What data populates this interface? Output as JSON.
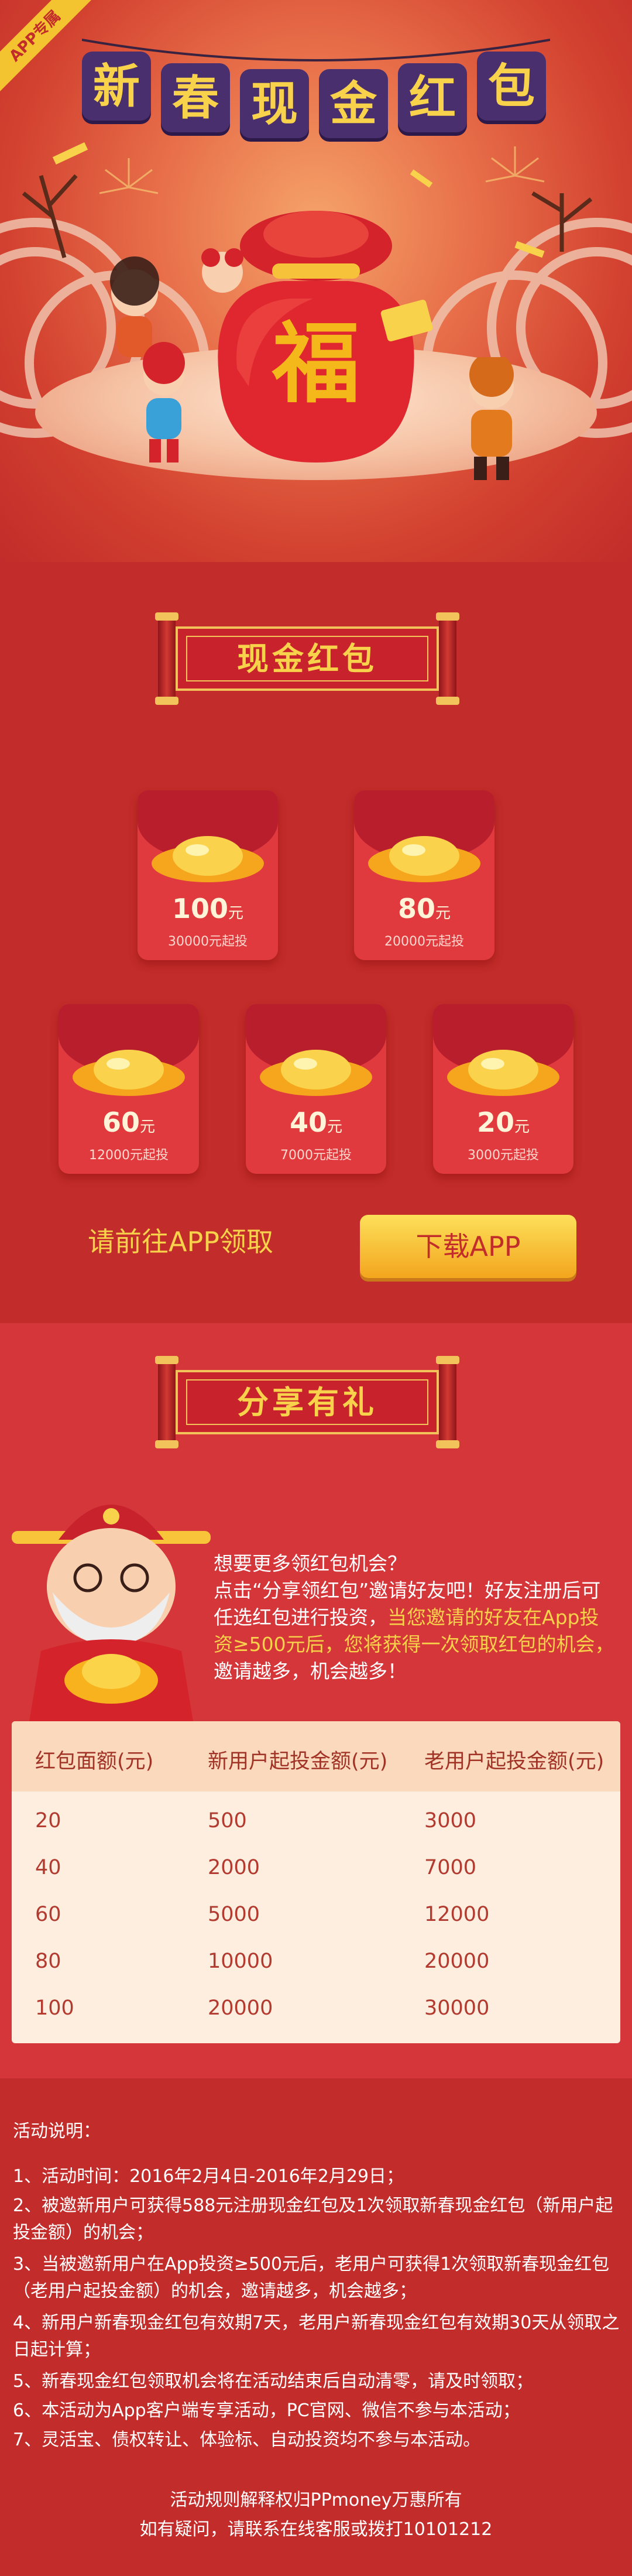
{
  "ribbon": "APP专属",
  "title_chars": [
    "新",
    "春",
    "现",
    "金",
    "红",
    "包"
  ],
  "bag_char": "福",
  "section1": {
    "banner": "现金红包",
    "envelopes": [
      {
        "amount": "100",
        "unit": "元",
        "condition": "30000元起投"
      },
      {
        "amount": "80",
        "unit": "元",
        "condition": "20000元起投"
      },
      {
        "amount": "60",
        "unit": "元",
        "condition": "12000元起投"
      },
      {
        "amount": "40",
        "unit": "元",
        "condition": "7000元起投"
      },
      {
        "amount": "20",
        "unit": "元",
        "condition": "3000元起投"
      }
    ],
    "goto_text": "请前往APP领取",
    "download_button": "下载APP"
  },
  "section2": {
    "banner": "分享有礼",
    "text_line1": "想要更多领红包机会？",
    "text_line2": "点击“分享领红包”邀请好友吧！好友注册后可任选红包进行投资，",
    "text_highlight": "当您邀请的好友在App投资≥500元后，您将获得一次领取红包的机会，",
    "text_end": "邀请越多，机会越多！",
    "table": {
      "headers": [
        "红包面额(元)",
        "新用户起投金额(元)",
        "老用户起投金额(元)"
      ],
      "rows": [
        [
          "20",
          "500",
          "3000"
        ],
        [
          "40",
          "2000",
          "7000"
        ],
        [
          "60",
          "5000",
          "12000"
        ],
        [
          "80",
          "10000",
          "20000"
        ],
        [
          "100",
          "20000",
          "30000"
        ]
      ]
    }
  },
  "rules": {
    "title": "活动说明：",
    "items": [
      "1、活动时间：2016年2月4日-2016年2月29日；",
      "2、被邀新用户可获得588元注册现金红包及1次领取新春现金红包（新用户起投金额）的机会；",
      "3、当被邀新用户在App投资≥500元后，老用户可获得1次领取新春现金红包（老用户起投金额）的机会，邀请越多，机会越多；",
      "4、新用户新春现金红包有效期7天，老用户新春现金红包有效期30天从领取之日起计算；",
      "5、新春现金红包领取机会将在活动结束后自动清零，请及时领取；",
      "6、本活动为App客户端专享活动，PC官网、微信不参与本活动；",
      "7、灵活宝、债权转让、体验标、自动投资均不参与本活动。"
    ],
    "footer1": "活动规则解释权归PPmoney万惠所有",
    "footer2": "如有疑问，请联系在线客服或拨打10101212"
  },
  "colors": {
    "background": "#c22c2a",
    "gold": "#f7d24a",
    "title_tile": "#4a2f6e",
    "envelope": "#e03a3e"
  }
}
